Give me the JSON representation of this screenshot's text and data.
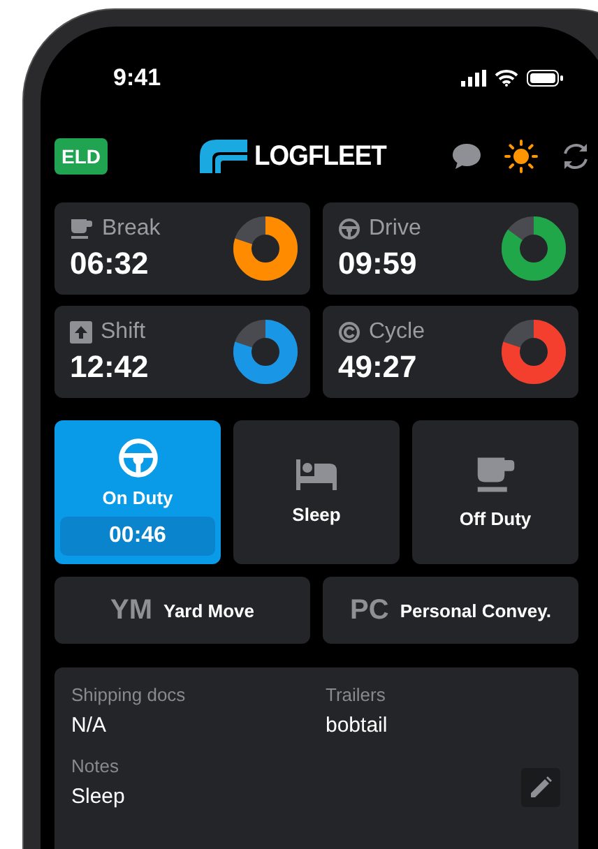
{
  "status_bar": {
    "time": "9:41"
  },
  "header": {
    "badge": "ELD",
    "logo": "LOGFLEET"
  },
  "timers": [
    {
      "label": "Break",
      "value": "06:32",
      "level": 0.8,
      "color": "#ff8c00",
      "kind": "cup"
    },
    {
      "label": "Drive",
      "value": "09:59",
      "level": 0.85,
      "color": "#1fa74a",
      "kind": "wheel"
    },
    {
      "label": "Shift",
      "value": "12:42",
      "level": 0.8,
      "color": "#1a96e6",
      "kind": "arrow"
    },
    {
      "label": "Cycle",
      "value": "49:27",
      "level": 0.8,
      "color": "#f43f2f",
      "kind": "cycle"
    }
  ],
  "duty_statuses": [
    {
      "label": "On Duty",
      "kind": "wheel",
      "selected": true,
      "timer": "00:46"
    },
    {
      "label": "Sleep",
      "kind": "bed",
      "selected": false
    },
    {
      "label": "Off Duty",
      "kind": "cup",
      "selected": false
    }
  ],
  "special_moves": [
    {
      "abbr": "YM",
      "label": "Yard Move"
    },
    {
      "abbr": "PC",
      "label": "Personal Convey."
    }
  ],
  "info": {
    "fields": [
      {
        "label": "Shipping docs",
        "value": "N/A"
      },
      {
        "label": "Trailers",
        "value": "bobtail"
      },
      {
        "label": "Notes",
        "value": "Sleep"
      }
    ]
  }
}
